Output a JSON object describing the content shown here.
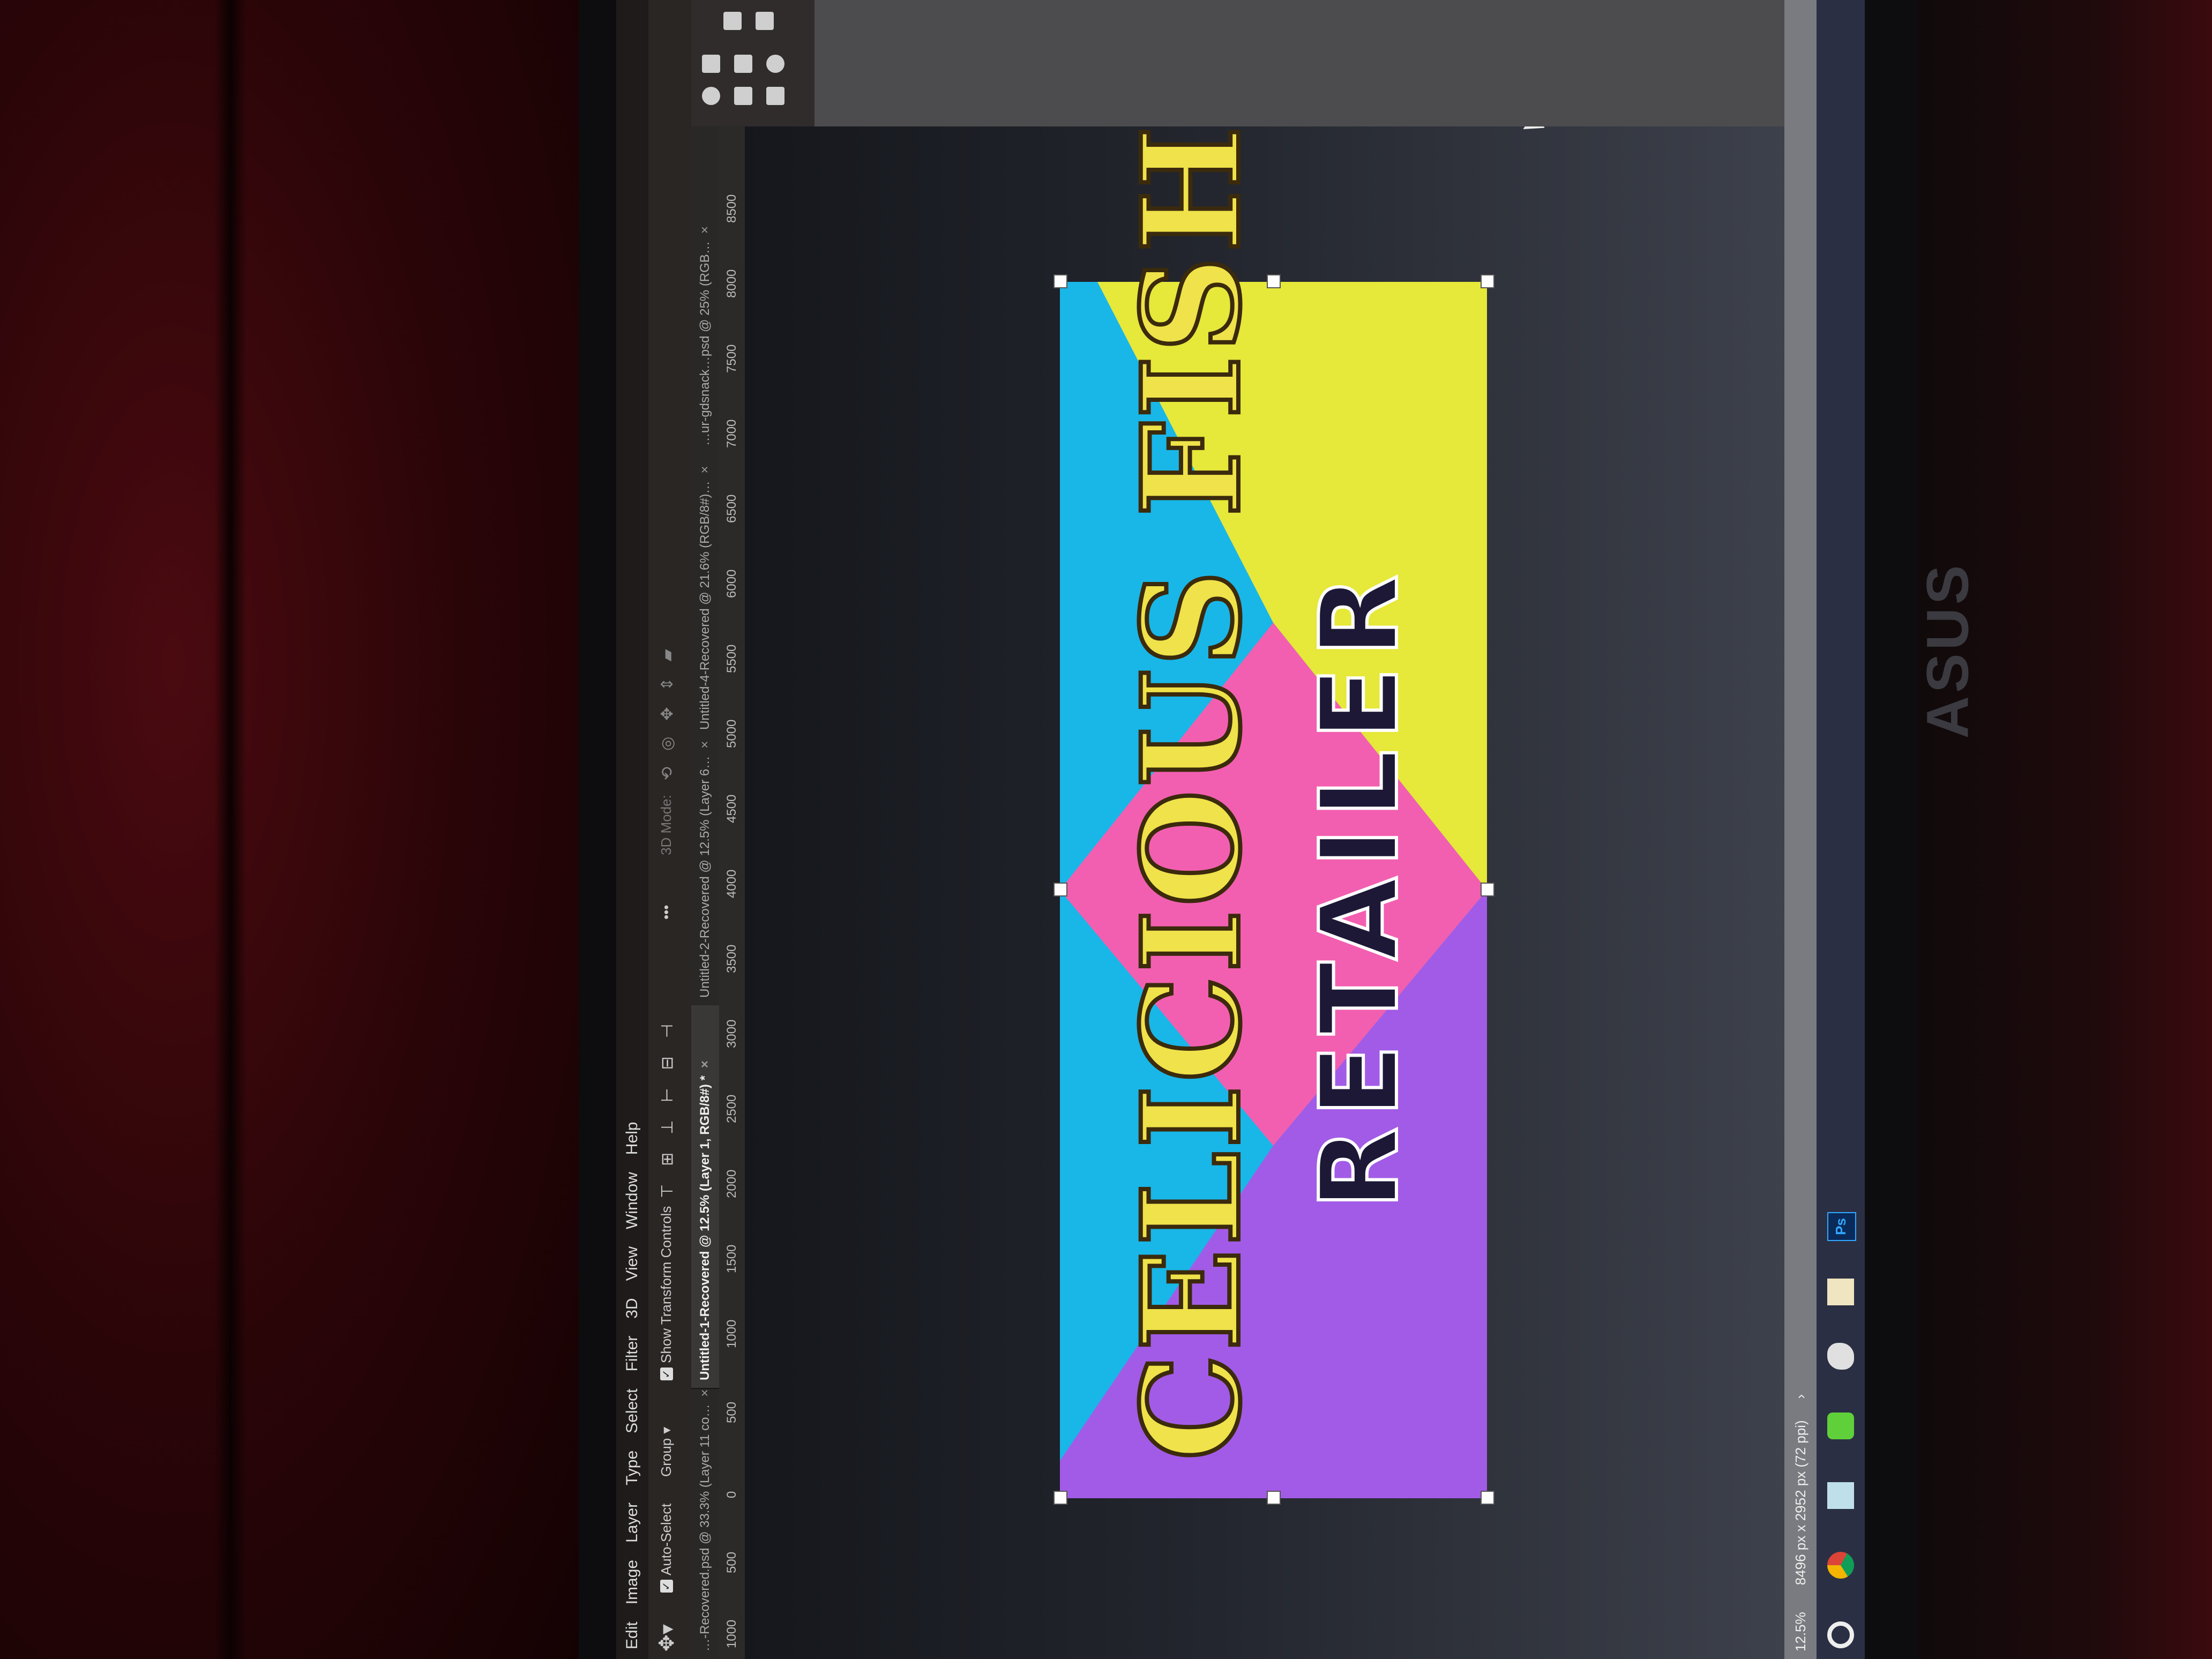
{
  "bezel": {
    "brand": "ASUS"
  },
  "menu": [
    "Edit",
    "Image",
    "Layer",
    "Type",
    "Select",
    "Filter",
    "3D",
    "View",
    "Window",
    "Help"
  ],
  "options": {
    "auto_select_label": "Auto-Select",
    "auto_select_checked": true,
    "group_value": "Group",
    "show_transform_label": "Show Transform Controls",
    "show_transform_checked": true,
    "more_label": "•••",
    "mode_3d_label": "3D Mode:"
  },
  "tabs": [
    {
      "label": "…-Recovered.psd @ 33.3% (Layer 11 co…",
      "close": "×",
      "active": false
    },
    {
      "label": "Untitled-1-Recovered @ 12.5% (Layer 1, RGB/8#) *",
      "close": "×",
      "active": true
    },
    {
      "label": "Untitled-2-Recovered @ 12.5% (Layer 6…",
      "close": "×",
      "active": false
    },
    {
      "label": "Untitled-4-Recovered @ 21.6% (RGB/8#)…",
      "close": "×",
      "active": false
    },
    {
      "label": "…ur-gdsnack…psd @ 25% (RGB…",
      "close": "×",
      "active": false
    }
  ],
  "ruler": [
    "1000",
    "500",
    "0",
    "500",
    "1000",
    "1500",
    "2000",
    "2500",
    "3000",
    "3500",
    "4000",
    "4500",
    "5000",
    "5500",
    "6000",
    "6500",
    "7000",
    "7500",
    "8000",
    "8500"
  ],
  "artwork": {
    "title_line": "CELICIOUS FISH",
    "subtitle_line": "RETAILER",
    "colors": {
      "cyan": "#19b6e8",
      "yellow": "#e6e83a",
      "pink": "#f25fb0",
      "purple": "#a25be6",
      "gold": "#efe24a",
      "navy": "#1c1836"
    }
  },
  "status": {
    "zoom": "12.5%",
    "doc_size": "8496 px x 2952 px (72 ppi)",
    "arrow": "›"
  },
  "taskbar": [
    "cortana-icon",
    "chrome-icon",
    "image-viewer-icon",
    "notepad-icon",
    "fish-app-icon",
    "file-explorer-icon",
    "photoshop-icon"
  ],
  "taskbar_ps_label": "Ps"
}
